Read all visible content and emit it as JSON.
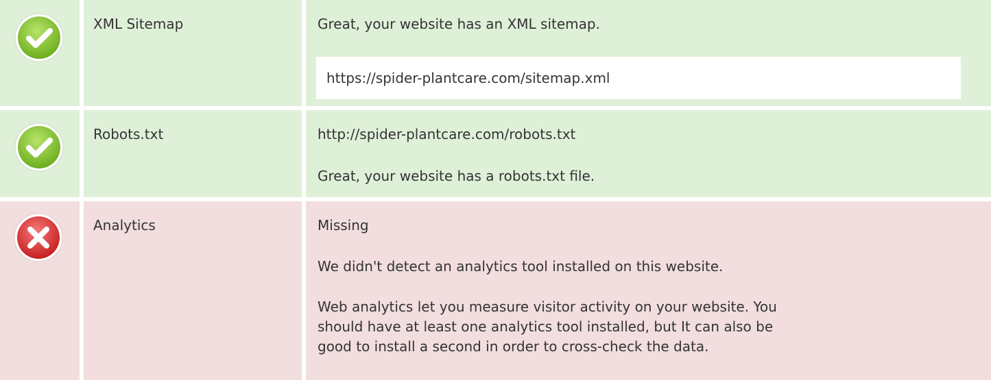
{
  "rows": [
    {
      "status": "pass",
      "icon": "check-circle-icon",
      "label": "XML Sitemap",
      "message": "Great, your website has an XML sitemap.",
      "url": "https://spider-plantcare.com/sitemap.xml"
    },
    {
      "status": "pass",
      "icon": "check-circle-icon",
      "label": "Robots.txt",
      "url": "http://spider-plantcare.com/robots.txt",
      "message": "Great, your website has a robots.txt file."
    },
    {
      "status": "fail",
      "icon": "x-circle-icon",
      "label": "Analytics",
      "value": "Missing",
      "message": "We didn't detect an analytics tool installed on this website.",
      "description_lines": [
        "Web analytics let you measure visitor activity on your website. You",
        "should have at least one analytics tool installed, but It can also be",
        "good to install a second in order to cross-check the data."
      ]
    }
  ],
  "colors": {
    "pass_bg": "#dff0d8",
    "fail_bg": "#f2dede",
    "pass_icon": "#8cc63f",
    "fail_icon": "#e03a3a"
  }
}
